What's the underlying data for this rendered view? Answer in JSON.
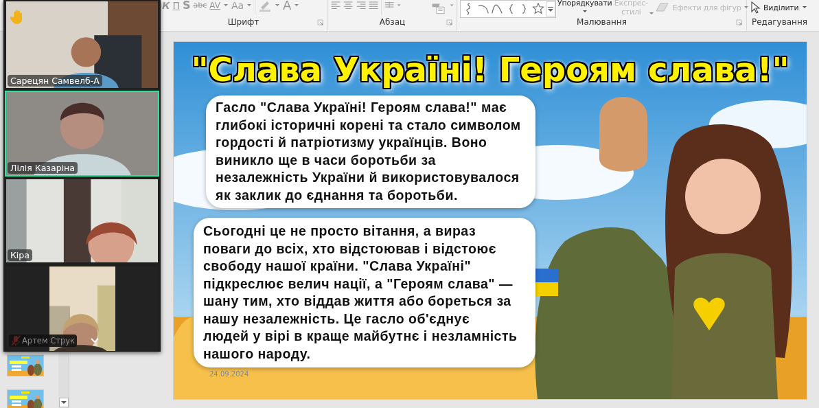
{
  "ribbon": {
    "groups": [
      {
        "kind": "font",
        "label": "Шрифт",
        "buttons": [
          "К",
          "П",
          "S",
          "abc",
          "AV",
          "Aa"
        ],
        "color_button": "A"
      },
      {
        "kind": "paragraph",
        "label": "Абзац"
      },
      {
        "kind": "drawing",
        "label": "Малювання",
        "arrange": "Упорядкувати",
        "quick_styles": {
          "label": "Експрес-стилі",
          "disabled": true
        },
        "shape_effects": {
          "label": "Ефекти для фігур",
          "disabled": true
        }
      },
      {
        "kind": "editing",
        "label": "Редагування",
        "select": "Виділити"
      }
    ]
  },
  "slide": {
    "title": "\"Слава Україні! Героям слава!\"",
    "paragraphs": [
      "Гасло \"Слава Україні! Героям слава!\" має глибокі історичні корені та стало символом гордості й патріотизму українців. Воно виникло ще в часи боротьби за незалежність України й використовувалося як заклик до єднання та боротьби.",
      "Сьогодні це не просто вітання, а вираз поваги до всіх, хто відстоював і відстоює свободу нашої країни. \"Слава Україні\" підкреслює велич нації, а \"Героям слава\" — шану тим, хто віддав життя або бореться за нашу незалежність. Це гасло об'єднує людей у вірі в краще майбутнє і незламність нашого народу."
    ],
    "date": "24.09.2024"
  },
  "video_call": {
    "raised_hand": true,
    "participants": [
      {
        "name": "Сарецян Самвелб-А",
        "speaking": false,
        "muted": false,
        "kind": "wide"
      },
      {
        "name": "Лілія Казаріна",
        "speaking": true,
        "muted": false,
        "kind": "wide"
      },
      {
        "name": "Кіра",
        "speaking": false,
        "muted": false,
        "kind": "wide"
      },
      {
        "name": "Артем Струк",
        "speaking": false,
        "muted": true,
        "kind": "narrow"
      }
    ]
  }
}
